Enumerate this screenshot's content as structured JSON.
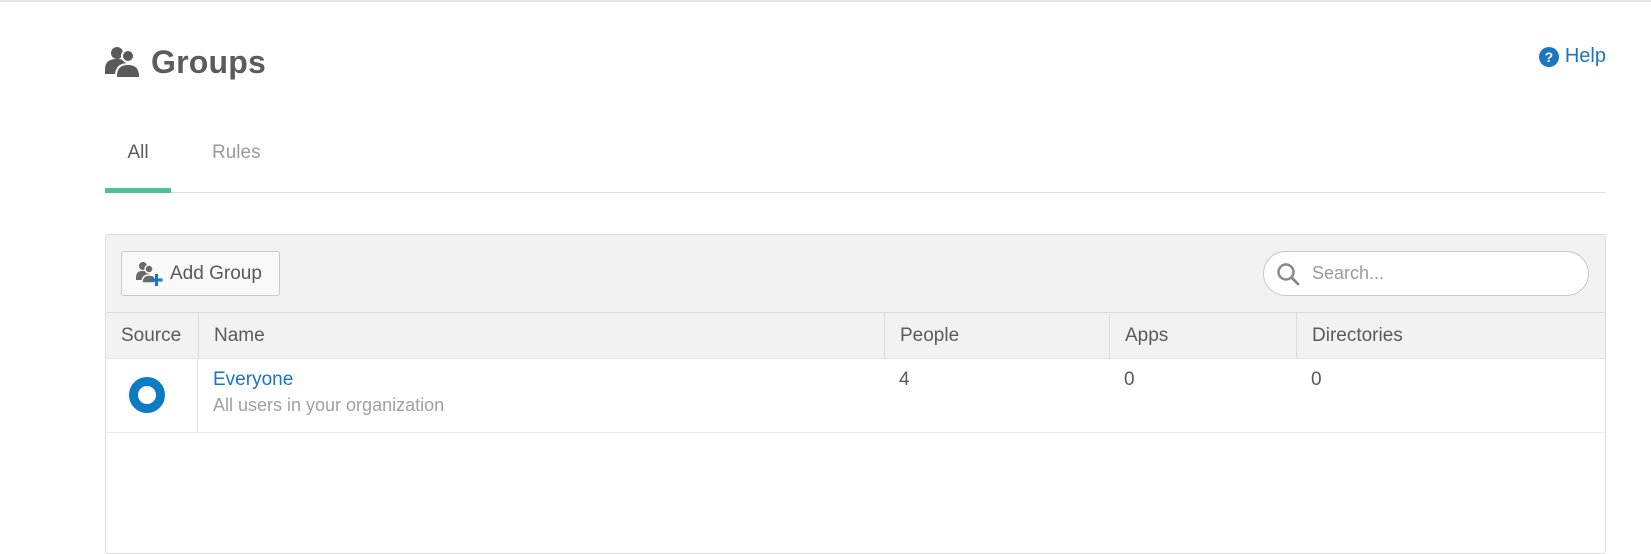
{
  "header": {
    "title": "Groups",
    "icon": "groups-icon"
  },
  "help": {
    "label": "Help",
    "icon": "help-circle-icon"
  },
  "tabs": [
    {
      "label": "All",
      "active": true
    },
    {
      "label": "Rules",
      "active": false
    }
  ],
  "toolbar": {
    "add_group_label": "Add Group",
    "add_group_icon": "add-group-icon",
    "search_placeholder": "Search..."
  },
  "table": {
    "columns": [
      "Source",
      "Name",
      "People",
      "Apps",
      "Directories"
    ],
    "rows": [
      {
        "source_icon": "okta-source-icon",
        "name": "Everyone",
        "description": "All users in your organization",
        "people": "4",
        "apps": "0",
        "directories": "0"
      }
    ]
  },
  "colors": {
    "accent_link": "#1a76c2",
    "tab_underline": "#4fbf99",
    "source_logo": "#0a7cc1"
  }
}
